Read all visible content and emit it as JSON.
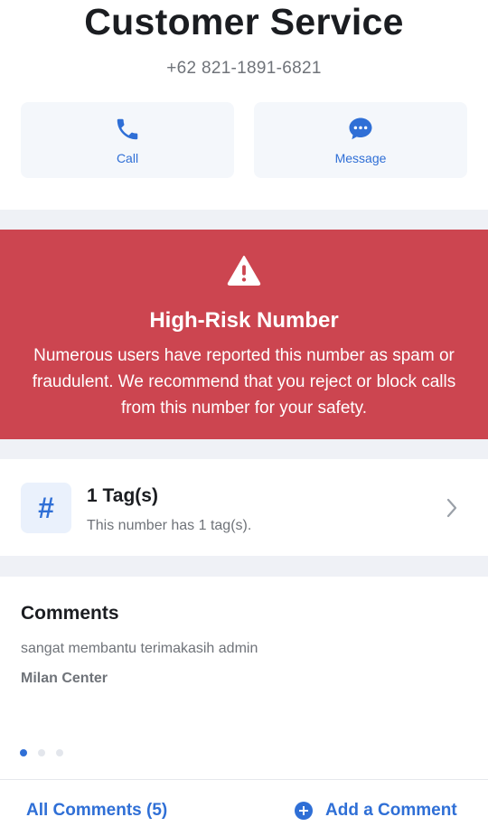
{
  "header": {
    "title": "Customer Service",
    "phone": "+62 821-1891-6821"
  },
  "actions": {
    "call_label": "Call",
    "message_label": "Message"
  },
  "alert": {
    "title": "High-Risk Number",
    "text": "Numerous users have reported this number as spam or fraudulent. We recommend that you reject or block calls from this number for your safety.",
    "icon": "warning-triangle-icon"
  },
  "tags": {
    "icon_glyph": "#",
    "title": "1 Tag(s)",
    "subtitle": "This number has 1 tag(s)."
  },
  "comments": {
    "heading": "Comments",
    "items": [
      {
        "text": "sangat membantu terimakasih admin",
        "author": "Milan Center"
      }
    ],
    "pager": {
      "current": 1,
      "total": 3
    }
  },
  "footer": {
    "all_comments": "All Comments (5)",
    "add_comment": "Add a Comment"
  },
  "colors": {
    "accent": "#2f6fd6",
    "alert_bg": "#cc4550",
    "muted_text": "#6f7379",
    "section_bg": "#eff1f6"
  }
}
